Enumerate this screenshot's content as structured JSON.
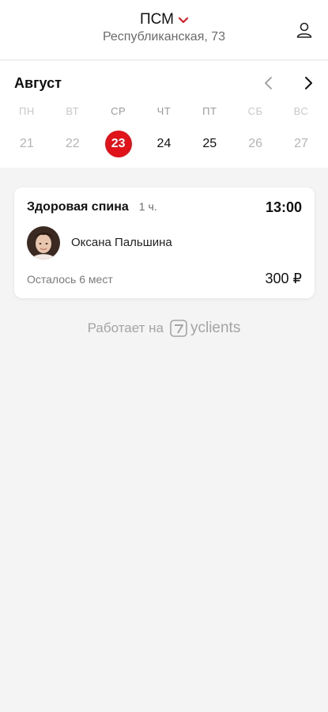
{
  "header": {
    "title": "ПСМ",
    "subtitle": "Республиканская, 73",
    "accent": "#e0131b"
  },
  "calendar": {
    "month": "Август",
    "weekdays": [
      "ПН",
      "ВТ",
      "СР",
      "ЧТ",
      "ПТ",
      "СБ",
      "ВС"
    ],
    "days": [
      "21",
      "22",
      "23",
      "24",
      "25",
      "26",
      "27"
    ],
    "selected_day": "23"
  },
  "card": {
    "service": "Здоровая спина",
    "duration": "1 ч.",
    "time": "13:00",
    "master": "Оксана Пальшина",
    "seats": "Осталось 6 мест",
    "price": "300 ₽"
  },
  "footer": {
    "powered_by": "Работает на",
    "brand": "yclients"
  }
}
